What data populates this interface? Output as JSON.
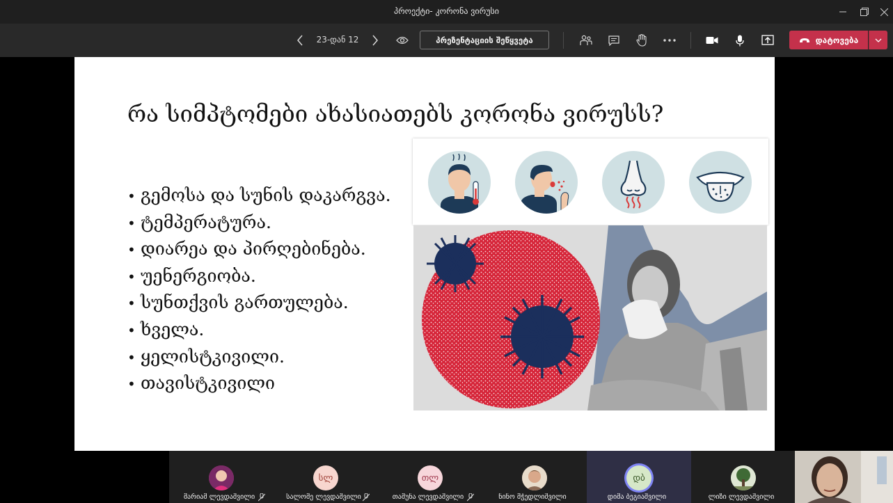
{
  "window": {
    "title": "პროექტი- კორონა ვირუსი"
  },
  "toolbar": {
    "slide_counter": "23-დან 12",
    "stop_presenting_label": "პრეზენტაციის შეწყვეტა",
    "leave_label": "დატოვება",
    "leave_color": "#c4314b"
  },
  "slide": {
    "title": "რა სიმპტომები ახასიათებს კორონა ვირუსს?",
    "bullets": [
      "გემოსა და სუნის დაკარგვა.",
      "ტემპერატურა.",
      "დიარეა და პირღებინება.",
      "უენერგიობა.",
      "სუნთქვის გართულება.",
      "ხველა.",
      "ყელისტკივილი.",
      "თავისტკივილი"
    ]
  },
  "participants": [
    {
      "name": "მარიამ ლევდაშვილი",
      "initials": "",
      "muted": true
    },
    {
      "name": "სალომე ლევდაშვილი",
      "initials": "სლ",
      "muted": true
    },
    {
      "name": "თამუნა ლევდაშვილი",
      "initials": "თლ",
      "muted": true
    },
    {
      "name": "ნინო მჭედლიშვილი",
      "initials": "",
      "muted": false
    },
    {
      "name": "დიმა ბეგიაშვილი",
      "initials": "დბ",
      "muted": false
    },
    {
      "name": "ლიზი ლევდაშვილი",
      "initials": "",
      "muted": false
    }
  ]
}
